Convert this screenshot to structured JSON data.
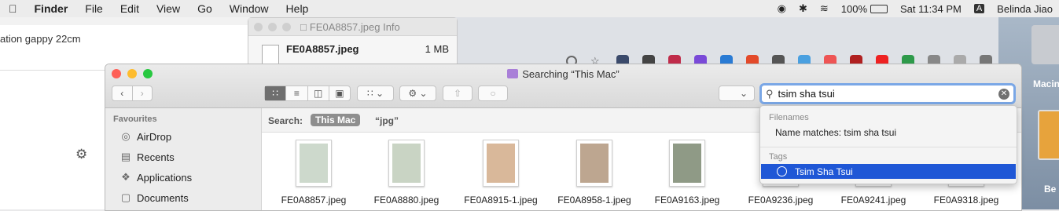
{
  "menubar": {
    "app_name": "Finder",
    "items": [
      "File",
      "Edit",
      "View",
      "Go",
      "Window",
      "Help"
    ],
    "battery": "100%",
    "clock": "Sat 11:34 PM",
    "input_source": "A",
    "user": "Belinda Jiao"
  },
  "left_pane": {
    "partial_text": "ation gappy 22cm"
  },
  "info_window": {
    "title": "FE0A8857.jpeg Info",
    "file_name": "FE0A8857.jpeg",
    "file_size": "1 MB"
  },
  "finder": {
    "window_title": "Searching “This Mac”",
    "search": {
      "value": "tsim sha tsui",
      "clear_glyph": "✕"
    },
    "scope": {
      "label": "Search:",
      "this_mac": "This Mac",
      "folder": "“jpg”"
    },
    "sidebar": {
      "header": "Favourites",
      "items": [
        {
          "label": "AirDrop",
          "icon": "airdrop-icon"
        },
        {
          "label": "Recents",
          "icon": "recents-icon"
        },
        {
          "label": "Applications",
          "icon": "applications-icon"
        },
        {
          "label": "Documents",
          "icon": "documents-icon"
        }
      ]
    },
    "files": [
      {
        "name": "FE0A8857.jpeg",
        "tint": "#cdd9cc"
      },
      {
        "name": "FE0A8880.jpeg",
        "tint": "#c9d4c4"
      },
      {
        "name": "FE0A8915-1.jpeg",
        "tint": "#d9b89a"
      },
      {
        "name": "FE0A8958-1.jpeg",
        "tint": "#bda690"
      },
      {
        "name": "FE0A9163.jpeg",
        "tint": "#8f9a86"
      },
      {
        "name": "FE0A9236.jpeg",
        "tint": "#cccccc"
      },
      {
        "name": "FE0A9241.jpeg",
        "tint": "#cccccc"
      },
      {
        "name": "FE0A9318.jpeg",
        "tint": "#cccccc"
      }
    ]
  },
  "dropdown": {
    "filenames_header": "Filenames",
    "filenames_row": "Name matches: tsim sha tsui",
    "tags_header": "Tags",
    "tag_row": "Tsim Sha Tsui"
  },
  "desktop": {
    "label1": "Macin",
    "label2": "Be"
  },
  "colors": {
    "selection_blue": "#1f57d6",
    "search_focus": "#7aa7e6"
  }
}
